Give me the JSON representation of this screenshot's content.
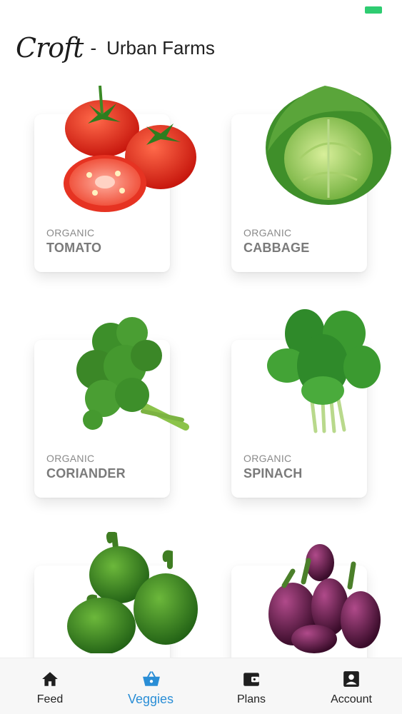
{
  "header": {
    "logo": "Croft",
    "separator": "-",
    "title": "Urban Farms"
  },
  "products": [
    {
      "subtitle": "ORGANIC",
      "name": "TOMATO"
    },
    {
      "subtitle": "ORGANIC",
      "name": "CABBAGE"
    },
    {
      "subtitle": "ORGANIC",
      "name": "CORIANDER"
    },
    {
      "subtitle": "ORGANIC",
      "name": "SPINACH"
    },
    {
      "subtitle": "",
      "name": ""
    },
    {
      "subtitle": "",
      "name": ""
    }
  ],
  "tabs": [
    {
      "label": "Feed",
      "icon": "home-icon"
    },
    {
      "label": "Veggies",
      "icon": "basket-icon",
      "active": true
    },
    {
      "label": "Plans",
      "icon": "wallet-icon"
    },
    {
      "label": "Account",
      "icon": "account-icon"
    }
  ],
  "colors": {
    "accent": "#2a8ed6",
    "status": "#2ecc71"
  }
}
